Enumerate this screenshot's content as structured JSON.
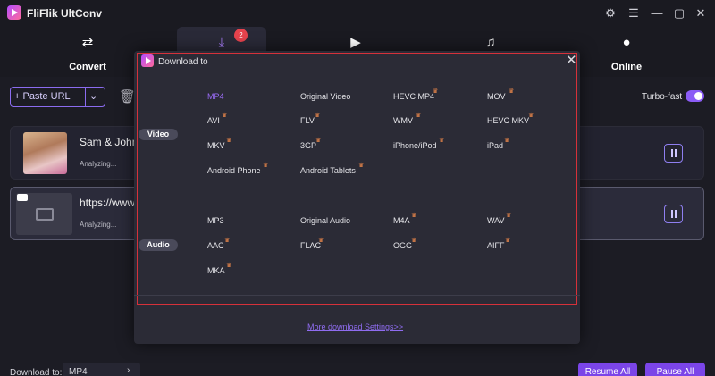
{
  "app": {
    "title": "FliFlik UltConv",
    "logo_icon": "app-logo-icon"
  },
  "window_controls": [
    "gear-icon",
    "menu-icon",
    "maximize-icon",
    "close-icon"
  ],
  "nav": {
    "tabs": [
      {
        "label": "Convert",
        "icon": "convert-icon"
      },
      {
        "label": "",
        "icon": "download-icon",
        "badge": "2",
        "active": true
      },
      {
        "label": "",
        "icon": "play-icon"
      },
      {
        "label": "",
        "icon": "music-icon"
      },
      {
        "label": "Online",
        "icon": "globe-icon"
      }
    ]
  },
  "toolbar": {
    "paste_label": "+ Paste URL",
    "turbo_label": "Turbo-fast",
    "turbo_on": true
  },
  "items": [
    {
      "title": "Sam & Johnn",
      "status": "Analyzing..."
    },
    {
      "title": "https://www",
      "status": "Analyzing..."
    }
  ],
  "footer": {
    "download_to_label": "Download to:",
    "download_to_value": "MP4",
    "resume_label": "Resume All",
    "pause_label": "Pause All"
  },
  "modal": {
    "title": "Download to",
    "video_label": "Video",
    "audio_label": "Audio",
    "video_formats": [
      [
        "MP4",
        "Original Video",
        "HEVC MP4",
        "MOV"
      ],
      [
        "AVI",
        "FLV",
        "WMV",
        "HEVC MKV"
      ],
      [
        "MKV",
        "3GP",
        "iPhone/iPod",
        "iPad"
      ],
      [
        "Android Phone",
        "Android Tablets"
      ]
    ],
    "audio_formats": [
      [
        "MP3",
        "Original Audio",
        "M4A",
        "WAV"
      ],
      [
        "AAC",
        "FLAC",
        "OGG",
        "AIFF"
      ],
      [
        "MKA"
      ]
    ],
    "selected_format": "MP4",
    "more_link": "More download Settings>>"
  },
  "colors": {
    "accent": "#7b45e8",
    "highlight_border": "#d6313a",
    "crown": "#f08a4b"
  }
}
